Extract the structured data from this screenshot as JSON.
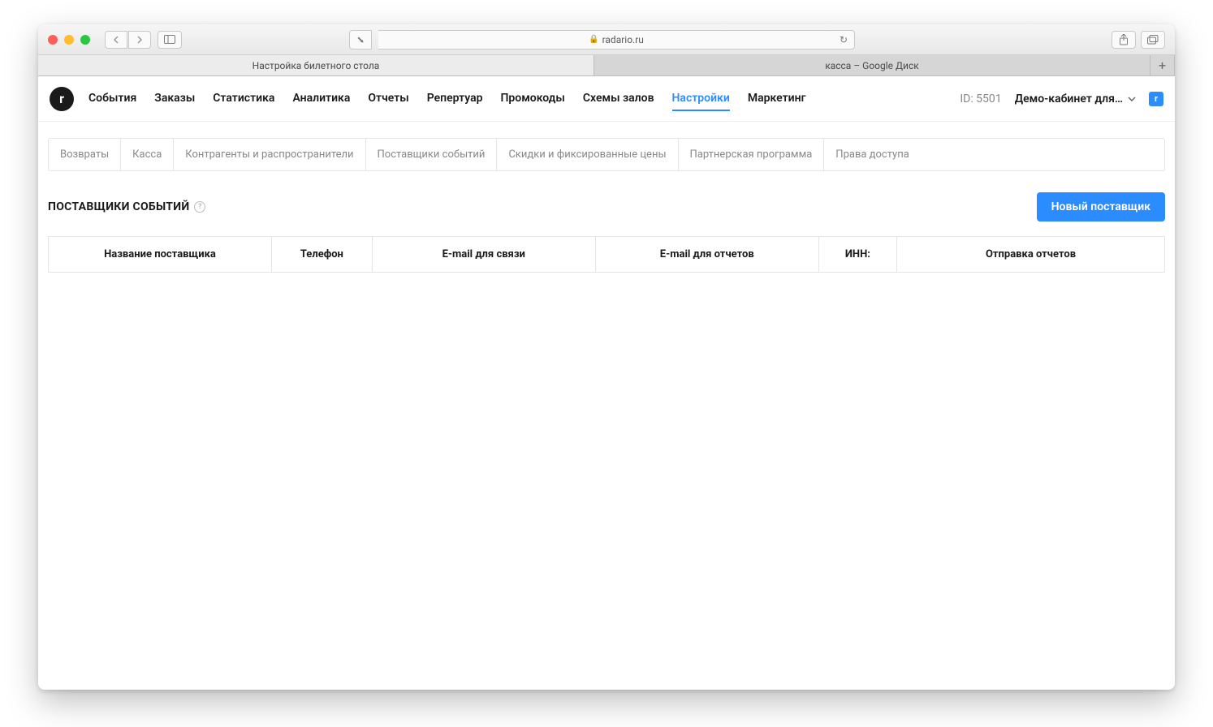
{
  "browser": {
    "url": "radario.ru",
    "tabs": [
      {
        "label": "Настройка билетного стола",
        "active": true
      },
      {
        "label": "касса – Google Диск",
        "active": false
      }
    ]
  },
  "nav": {
    "items": [
      "События",
      "Заказы",
      "Статистика",
      "Аналитика",
      "Отчеты",
      "Репертуар",
      "Промокоды",
      "Схемы залов",
      "Настройки",
      "Маркетинг"
    ],
    "active_index": 8,
    "id_label": "ID: 5501",
    "account": "Демо-кабинет для…"
  },
  "subnav": {
    "items": [
      "Возвраты",
      "Касса",
      "Контрагенты и распространители",
      "Поставщики событий",
      "Скидки и фиксированные цены",
      "Партнерская программа",
      "Права доступа"
    ]
  },
  "page": {
    "title": "ПОСТАВЩИКИ СОБЫТИЙ",
    "new_button": "Новый поставщик"
  },
  "table": {
    "headers": [
      "Название поставщика",
      "Телефон",
      "E-mail для связи",
      "E-mail для отчетов",
      "ИНН:",
      "Отправка отчетов"
    ]
  }
}
